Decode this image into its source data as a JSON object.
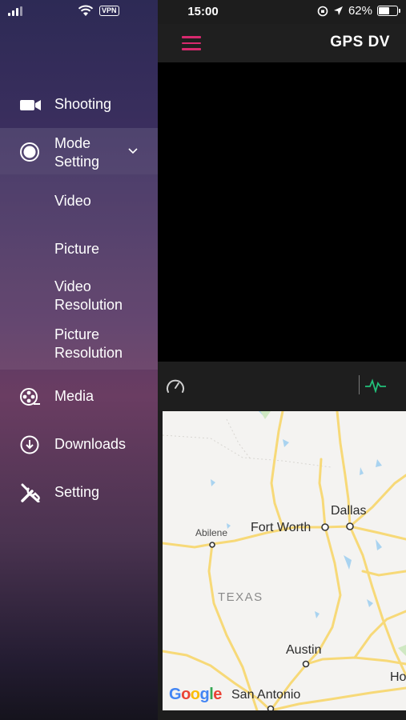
{
  "status_bar": {
    "time": "15:00",
    "vpn": "VPN",
    "battery": "62%",
    "battery_level": 0.62
  },
  "app": {
    "title": "GPS DV"
  },
  "drawer": {
    "items": [
      {
        "label": "Shooting",
        "icon": "video-camera-icon"
      },
      {
        "label": "Mode Setting",
        "line1": "Mode",
        "line2": "Setting",
        "icon": "record-icon",
        "expanded": true,
        "subitems": [
          {
            "label": "Video"
          },
          {
            "label": "Picture"
          },
          {
            "label": "Video Resolution",
            "line1": "Video",
            "line2": "Resolution"
          },
          {
            "label": "Picture Resolution",
            "line1": "Picture",
            "line2": "Resolution"
          }
        ]
      },
      {
        "label": "Media",
        "icon": "film-reel-icon"
      },
      {
        "label": "Downloads",
        "icon": "download-icon"
      },
      {
        "label": "Setting",
        "icon": "tools-icon"
      }
    ]
  },
  "infobar": {
    "speed_icon": "speedometer-icon",
    "pulse_icon": "pulse-icon",
    "pulse_color": "#22c07a"
  },
  "map": {
    "labels": {
      "dallas": "Dallas",
      "fort_worth": "Fort Worth",
      "abilene": "Abilene",
      "texas": "TEXAS",
      "austin": "Austin",
      "san_antonio": "San Antonio",
      "houston_partial": "Ho"
    },
    "attribution": "Google"
  },
  "colors": {
    "accent": "#d8296e",
    "road": "#f7d978",
    "water": "#a9d3f0"
  }
}
